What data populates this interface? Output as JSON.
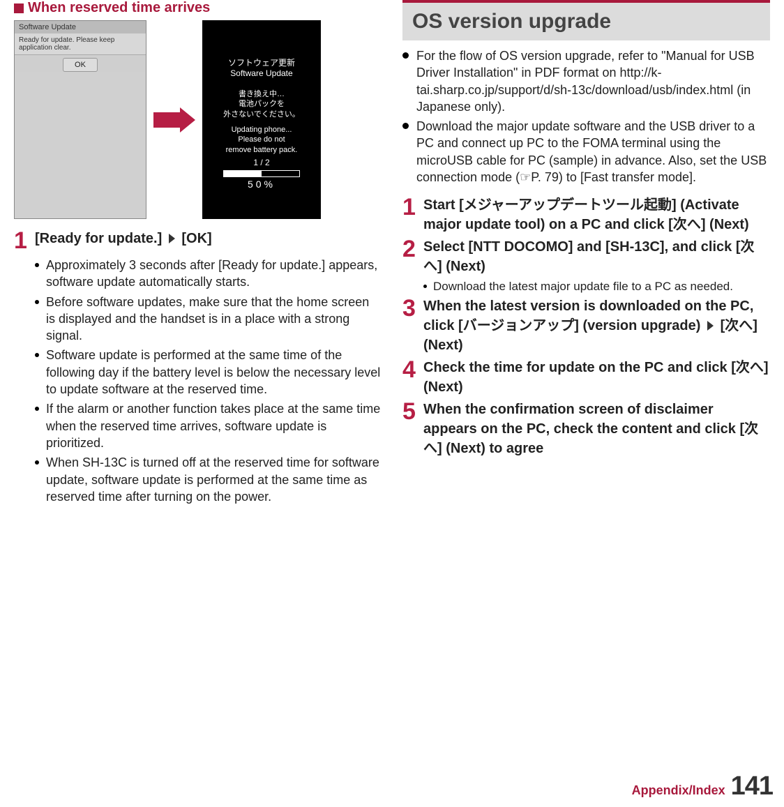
{
  "left": {
    "heading": "When reserved time arrives",
    "shot1": {
      "header": "Software Update",
      "msg": "Ready for update. Please keep application clear.",
      "ok": "OK"
    },
    "shot2": {
      "jp1": "ソフトウェア更新",
      "en1": "Software Update",
      "jp2": "書き換え中…\n電池パックを\n外さないでください。",
      "en2": "Updating phone...\nPlease do not\nremove battery pack.",
      "count": "1 / 2",
      "pct": "50%"
    },
    "step1": {
      "num": "1",
      "head_a": "[Ready for update.]",
      "head_b": "[OK]",
      "bullets": [
        "Approximately 3 seconds after [Ready for update.] appears, software update automatically starts.",
        "Before software updates, make sure that the home screen is displayed and the handset is in a place with a strong signal.",
        "Software update is performed at the same time of the following day if the battery level is below the necessary level to update software at the reserved time.",
        "If the alarm or another function takes place at the same time when the reserved time arrives, software update is prioritized.",
        "When SH-13C is turned off at the reserved time for software update, software update is performed at the same time as reserved time after turning on the power."
      ]
    }
  },
  "right": {
    "title": "OS version upgrade",
    "intro": [
      "For the flow of OS version upgrade, refer to \"Manual for USB Driver Installation\" in PDF format on http://k-tai.sharp.co.jp/support/d/sh-13c/download/usb/index.html (in Japanese only).",
      "Download the major update software and the USB driver to a PC and connect up PC to the FOMA terminal using the microUSB cable for PC (sample) in advance. Also, set the USB connection mode (☞P. 79) to [Fast transfer mode]."
    ],
    "steps": [
      {
        "num": "1",
        "head": "Start [メジャーアップデートツール起動] (Activate major update tool) on a PC and click [次へ] (Next)"
      },
      {
        "num": "2",
        "head": "Select [NTT DOCOMO] and [SH-13C], and click [次へ] (Next)",
        "sub": [
          "Download the latest major update file to a PC as needed."
        ]
      },
      {
        "num": "3",
        "head_a": "When the latest version is downloaded on the PC, click [バージョンアップ] (version upgrade)",
        "head_b": "[次へ] (Next)"
      },
      {
        "num": "4",
        "head": "Check the time for update on the PC and click [次へ] (Next)"
      },
      {
        "num": "5",
        "head": "When the confirmation screen of disclaimer appears on the PC, check the content and click [次へ] (Next) to agree"
      }
    ]
  },
  "footer": {
    "label": "Appendix/Index",
    "page": "141"
  }
}
